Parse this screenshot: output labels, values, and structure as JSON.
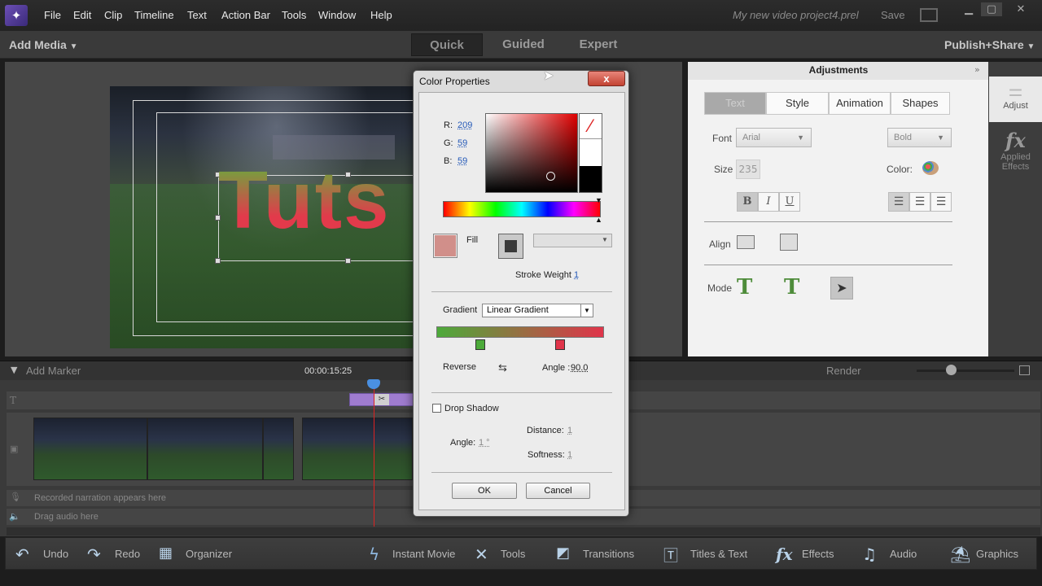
{
  "menubar": {
    "items": [
      "File",
      "Edit",
      "Clip",
      "Timeline",
      "Text",
      "Action Bar",
      "Tools",
      "Window",
      "Help"
    ],
    "project_title": "My new video project4.prel",
    "save": "Save"
  },
  "modebar": {
    "add_media": "Add Media",
    "tabs": [
      "Quick",
      "Guided",
      "Expert"
    ],
    "publish": "Publish+Share"
  },
  "monitor": {
    "title_text": "Tuts"
  },
  "adjustments": {
    "header": "Adjustments",
    "tabs": [
      "Text",
      "Style",
      "Animation",
      "Shapes"
    ],
    "font_label": "Font",
    "font_value": "Arial",
    "style_value": "Bold",
    "size_label": "Size",
    "size_value": "235",
    "color_label": "Color:",
    "bold": "B",
    "italic": "I",
    "underline": "U",
    "align_label": "Align",
    "mode_label": "Mode"
  },
  "right_strip": {
    "adjust": "Adjust",
    "applied_effects_1": "Applied",
    "applied_effects_2": "Effects"
  },
  "timeline": {
    "add_marker": "Add Marker",
    "timecode": "00:00:15:25",
    "render": "Render",
    "narration": "Recorded narration appears here",
    "audio": "Drag audio here"
  },
  "actionbar": {
    "undo": "Undo",
    "redo": "Redo",
    "organizer": "Organizer",
    "instant_movie": "Instant Movie",
    "tools": "Tools",
    "transitions": "Transitions",
    "titles_text": "Titles & Text",
    "effects": "Effects",
    "audio": "Audio",
    "graphics": "Graphics"
  },
  "dialog": {
    "title": "Color Properties",
    "close": "x",
    "r_label": "R:",
    "r_value": "209",
    "g_label": "G:",
    "g_value": "59",
    "b_label": "B:",
    "b_value": "59",
    "fill_label": "Fill",
    "stroke_weight_label": "Stroke Weight",
    "stroke_weight_value": "1",
    "gradient_label": "Gradient",
    "gradient_value": "Linear Gradient",
    "reverse_label": "Reverse",
    "angle_label": "Angle :",
    "angle_value": "90.0",
    "drop_shadow_label": "Drop Shadow",
    "distance_label": "Distance:",
    "distance_value": "1",
    "shadow_angle_label": "Angle:",
    "shadow_angle_value": "1 °",
    "softness_label": "Softness:",
    "softness_value": "1",
    "ok": "OK",
    "cancel": "Cancel"
  },
  "colors": {
    "fill_swatch": "#d18f8a",
    "selected_color": "#d13b3b",
    "gradient_start": "#4caa3a",
    "gradient_end": "#e0344a"
  }
}
